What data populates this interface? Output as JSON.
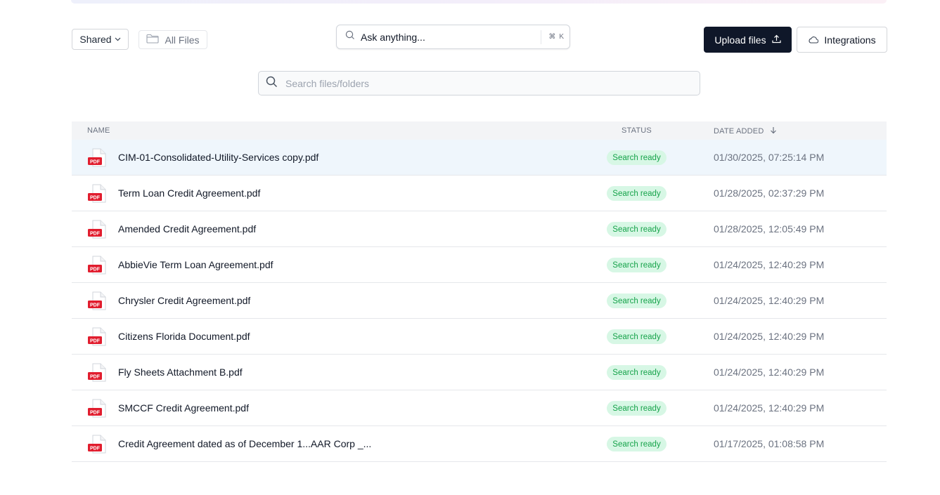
{
  "toolbar": {
    "shared_label": "Shared",
    "all_files_label": "All Files",
    "ask_placeholder": "Ask anything...",
    "ask_shortcut": "K",
    "upload_label": "Upload files",
    "integrations_label": "Integrations"
  },
  "search": {
    "placeholder": "Search files/folders"
  },
  "table": {
    "headers": {
      "name": "NAME",
      "status": "STATUS",
      "date": "DATE ADDED"
    },
    "rows": [
      {
        "name": "CIM-01-Consolidated-Utility-Services copy.pdf",
        "status": "Search ready",
        "date": "01/30/2025, 07:25:14 PM"
      },
      {
        "name": "Term Loan Credit Agreement.pdf",
        "status": "Search ready",
        "date": "01/28/2025, 02:37:29 PM"
      },
      {
        "name": "Amended Credit Agreement.pdf",
        "status": "Search ready",
        "date": "01/28/2025, 12:05:49 PM"
      },
      {
        "name": "AbbieVie Term Loan Agreement.pdf",
        "status": "Search ready",
        "date": "01/24/2025, 12:40:29 PM"
      },
      {
        "name": "Chrysler Credit Agreement.pdf",
        "status": "Search ready",
        "date": "01/24/2025, 12:40:29 PM"
      },
      {
        "name": "Citizens Florida Document.pdf",
        "status": "Search ready",
        "date": "01/24/2025, 12:40:29 PM"
      },
      {
        "name": "Fly Sheets Attachment B.pdf",
        "status": "Search ready",
        "date": "01/24/2025, 12:40:29 PM"
      },
      {
        "name": "SMCCF Credit Agreement.pdf",
        "status": "Search ready",
        "date": "01/24/2025, 12:40:29 PM"
      },
      {
        "name": "Credit Agreement dated as of December 1...AAR Corp _...",
        "status": "Search ready",
        "date": "01/17/2025, 01:08:58 PM"
      }
    ]
  },
  "icons": {
    "pdf_badge_text": "PDF",
    "pdf_color": "#e11d2e"
  }
}
